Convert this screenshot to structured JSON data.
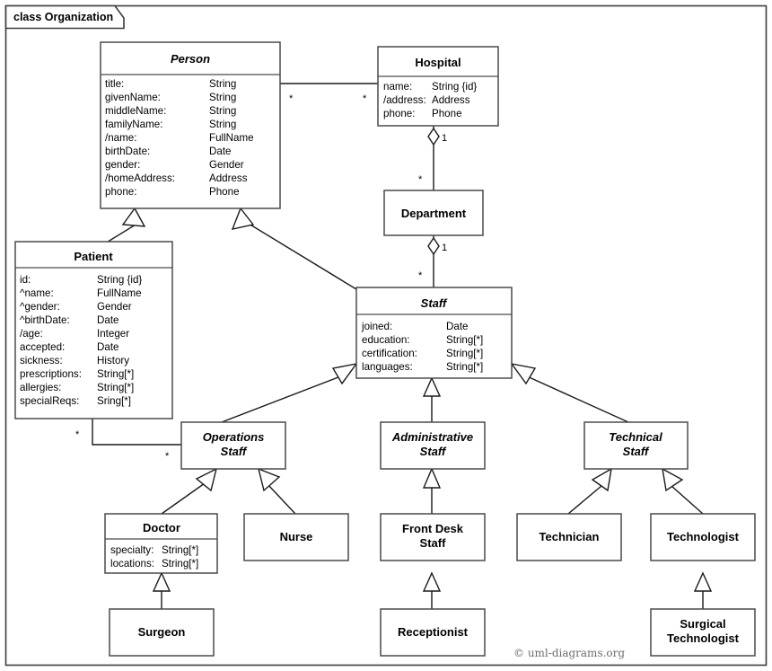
{
  "frame": {
    "label": "class Organization"
  },
  "copyright": "© uml-diagrams.org",
  "classes": {
    "person": {
      "name": "Person",
      "abstract": true,
      "attributes": [
        {
          "name": "title:",
          "type": "String"
        },
        {
          "name": "givenName:",
          "type": "String"
        },
        {
          "name": "middleName:",
          "type": "String"
        },
        {
          "name": "familyName:",
          "type": "String"
        },
        {
          "name": "/name:",
          "type": "FullName"
        },
        {
          "name": "birthDate:",
          "type": "Date"
        },
        {
          "name": "gender:",
          "type": "Gender"
        },
        {
          "name": "/homeAddress:",
          "type": "Address"
        },
        {
          "name": "phone:",
          "type": "Phone"
        }
      ]
    },
    "hospital": {
      "name": "Hospital",
      "abstract": false,
      "attributes": [
        {
          "name": "name:",
          "type": "String {id}"
        },
        {
          "name": "/address:",
          "type": "Address"
        },
        {
          "name": "phone:",
          "type": "Phone"
        }
      ]
    },
    "department": {
      "name": "Department",
      "abstract": false,
      "attributes": []
    },
    "patient": {
      "name": "Patient",
      "abstract": false,
      "attributes": [
        {
          "name": "id:",
          "type": "String {id}"
        },
        {
          "name": "^name:",
          "type": "FullName"
        },
        {
          "name": "^gender:",
          "type": "Gender"
        },
        {
          "name": "^birthDate:",
          "type": "Date"
        },
        {
          "name": "/age:",
          "type": "Integer"
        },
        {
          "name": "accepted:",
          "type": "Date"
        },
        {
          "name": "sickness:",
          "type": "History"
        },
        {
          "name": "prescriptions:",
          "type": "String[*]"
        },
        {
          "name": "allergies:",
          "type": "String[*]"
        },
        {
          "name": "specialReqs:",
          "type": "Sring[*]"
        }
      ]
    },
    "staff": {
      "name": "Staff",
      "abstract": true,
      "attributes": [
        {
          "name": "joined:",
          "type": "Date"
        },
        {
          "name": "education:",
          "type": "String[*]"
        },
        {
          "name": "certification:",
          "type": "String[*]"
        },
        {
          "name": "languages:",
          "type": "String[*]"
        }
      ]
    },
    "operations_staff": {
      "name_line1": "Operations",
      "name_line2": "Staff",
      "abstract": true
    },
    "administrative_staff": {
      "name_line1": "Administrative",
      "name_line2": "Staff",
      "abstract": true
    },
    "technical_staff": {
      "name_line1": "Technical",
      "name_line2": "Staff",
      "abstract": true
    },
    "doctor": {
      "name": "Doctor",
      "abstract": false,
      "attributes": [
        {
          "name": "specialty:",
          "type": "String[*]"
        },
        {
          "name": "locations:",
          "type": "String[*]"
        }
      ]
    },
    "nurse": {
      "name": "Nurse",
      "abstract": false
    },
    "front_desk_staff": {
      "name_line1": "Front Desk",
      "name_line2": "Staff",
      "abstract": false
    },
    "technician": {
      "name": "Technician",
      "abstract": false
    },
    "technologist": {
      "name": "Technologist",
      "abstract": false
    },
    "surgeon": {
      "name": "Surgeon",
      "abstract": false
    },
    "receptionist": {
      "name": "Receptionist",
      "abstract": false
    },
    "surgical_technologist": {
      "name_line1": "Surgical",
      "name_line2": "Technologist",
      "abstract": false
    }
  },
  "multiplicities": {
    "person_hospital_person_end": "*",
    "person_hospital_hospital_end": "*",
    "hospital_department_hospital_end": "1",
    "hospital_department_department_end": "*",
    "department_staff_department_end": "1",
    "department_staff_staff_end": "*",
    "patient_operations_patient_end": "*",
    "patient_operations_operations_end": "*"
  },
  "colors": {
    "box_stroke": "#4a4a4a",
    "line": "#1a1a1a",
    "frame": "#3b3b3b",
    "background": "#ffffff",
    "copyright_text": "#6d6d6d"
  }
}
